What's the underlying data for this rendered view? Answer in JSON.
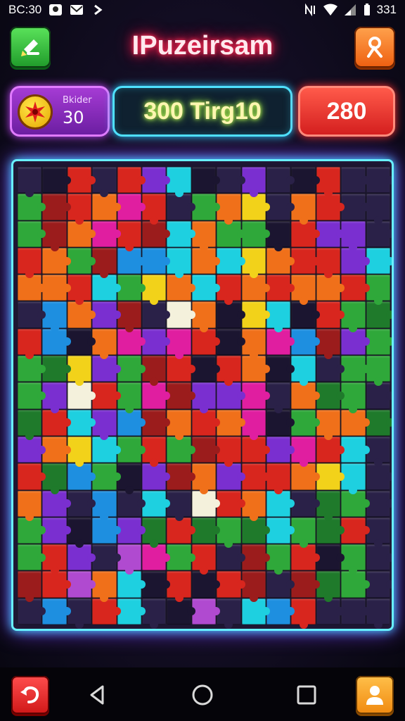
{
  "status_bar": {
    "time": "BC:30",
    "battery_text": "331"
  },
  "header": {
    "title": "IPuzeirsam"
  },
  "score": {
    "coins_label": "Bkider",
    "coins_value": "30",
    "center_text": "300 Tirg10",
    "right_value": "280"
  },
  "icons": {
    "back": "back-arrow-icon",
    "profile": "profile-icon",
    "coin": "coin-icon",
    "undo": "undo-icon",
    "user": "user-icon",
    "nav_back": "nav-back-icon",
    "nav_home": "nav-home-icon",
    "nav_recents": "nav-recents-icon"
  },
  "colors": {
    "title_glow": "#ff2d55",
    "board_border": "#68f0ff",
    "palette": {
      "R": "#d8261e",
      "D": "#9b1c1c",
      "O": "#f0701a",
      "Y": "#f2d21a",
      "G": "#2fa83a",
      "g": "#1f7a2b",
      "B": "#1e8fe0",
      "C": "#1ed0e0",
      "P": "#7a2fd0",
      "p": "#4a2a8a",
      "M": "#e01ea0",
      "m": "#b04ad0",
      "W": "#f4f1dc",
      "K": "#1b1530",
      "N": "#2a2148"
    }
  },
  "board": {
    "rows": [
      "NKRNRPCKNPNKRNN",
      "GDROMRNGOYNORNN",
      "GDOMRDCOGGKRPPN",
      "ROGDBBCOCYORRPC",
      "OORCGYOCROROORG",
      "NBOPDNWOKYCKRGg",
      "RBKOMPMRKOMBDPG",
      "GgYPGDRKROKCNGG",
      "GPWRGMDPPMNOgGN",
      "gRCPBDOROMKGOOg",
      "POYCGRGDRRPMRCN",
      "RgBGKPDOPRROYCN",
      "OPNBNCNWROCNgGN",
      "GPKBPgRgGgCGgRN",
      "GRPNmMGRNDGRKGN",
      "DRmOCKRKRDNDgGN",
      "NBNRCNKmNCBRNNN"
    ]
  }
}
